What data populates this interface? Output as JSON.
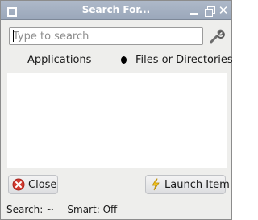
{
  "window": {
    "title": "Search For..."
  },
  "search": {
    "placeholder": "Type to search",
    "value": ""
  },
  "icons": {
    "tools": "tools-icon",
    "close": "close-icon",
    "launch": "lightning-icon"
  },
  "search_type": {
    "options": [
      {
        "label": "Applications",
        "selected": false
      },
      {
        "label": "Files or Directories",
        "selected": true
      }
    ]
  },
  "results": [],
  "buttons": {
    "close_label": "Close",
    "launch_label": "Launch Item"
  },
  "status": {
    "text": "Search: ~ -- Smart: Off"
  },
  "colors": {
    "titlebar": "#a3afc1",
    "window_bg": "#eeeeec",
    "close_icon": "#d23a30",
    "launch_icon": "#f2c21b"
  }
}
